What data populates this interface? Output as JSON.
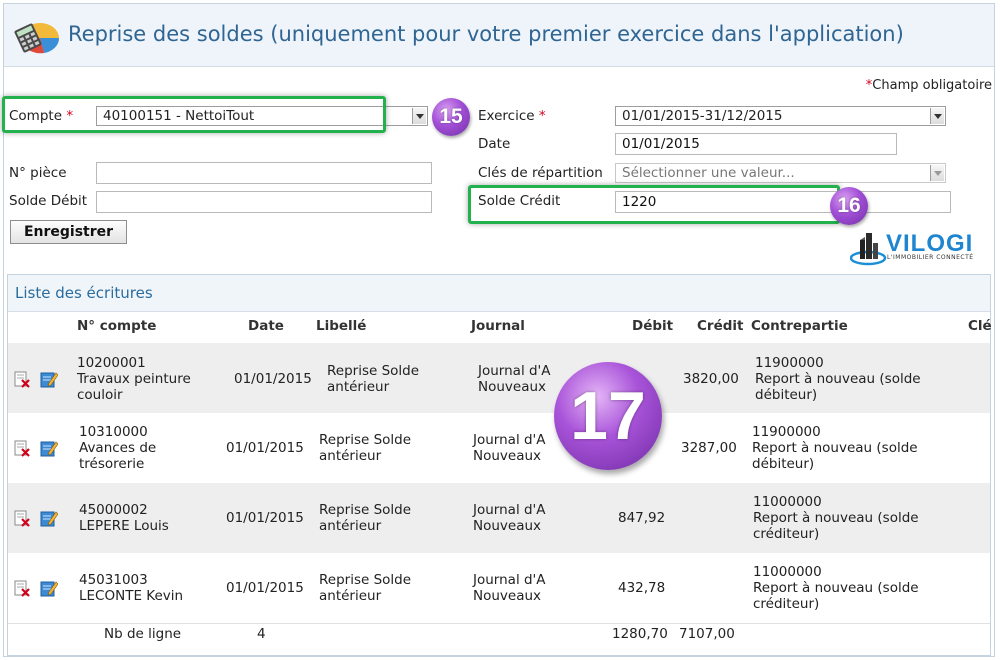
{
  "page": {
    "title": "Reprise des soldes (uniquement pour votre premier exercice dans l'application)",
    "required_note_star": "*",
    "required_note": "Champ obligatoire"
  },
  "form": {
    "compte_label": "Compte",
    "compte_required": "*",
    "compte_value": "40100151 - NettoiTout",
    "exercice_label": "Exercice",
    "exercice_required": "*",
    "exercice_value": "01/01/2015-31/12/2015",
    "date_label": "Date",
    "date_value": "01/01/2015",
    "piece_label": "N° pièce",
    "piece_value": "",
    "cles_label": "Clés de répartition",
    "cles_placeholder": "Sélectionner une valeur...",
    "solde_debit_label": "Solde Débit",
    "solde_debit_value": "",
    "solde_credit_label": "Solde Crédit",
    "solde_credit_value": "1220",
    "save_label": "Enregistrer"
  },
  "badges": {
    "b15": "15",
    "b16": "16",
    "b17": "17"
  },
  "logo": {
    "text": "VILOGI",
    "tagline": "L'IMMOBILIER CONNECTÉ"
  },
  "list": {
    "title": "Liste des écritures",
    "columns": {
      "compte": "N° compte",
      "date": "Date",
      "libelle": "Libellé",
      "journal": "Journal",
      "debit": "Débit",
      "credit": "Crédit",
      "contrepartie": "Contrepartie",
      "cle": "Clé"
    },
    "rows": [
      {
        "compte_num": "10200001",
        "compte_name_1": "Travaux peinture",
        "compte_name_2": "couloir",
        "date": "01/01/2015",
        "libelle_1": "Reprise Solde",
        "libelle_2": "antérieur",
        "journal_1": "Journal d'A",
        "journal_2": "Nouveaux",
        "debit": "",
        "credit": "3820,00",
        "cp_num": "11900000",
        "cp_1": "Report à nouveau (solde",
        "cp_2": "débiteur)"
      },
      {
        "compte_num": "10310000",
        "compte_name_1": "Avances de",
        "compte_name_2": "trésorerie",
        "date": "01/01/2015",
        "libelle_1": "Reprise Solde",
        "libelle_2": "antérieur",
        "journal_1": "Journal d'A",
        "journal_2": "Nouveaux",
        "debit": "",
        "credit": "3287,00",
        "cp_num": "11900000",
        "cp_1": "Report à nouveau (solde",
        "cp_2": "débiteur)"
      },
      {
        "compte_num": "45000002",
        "compte_name_1": "LEPERE Louis",
        "compte_name_2": "",
        "date": "01/01/2015",
        "libelle_1": "Reprise Solde",
        "libelle_2": "antérieur",
        "journal_1": "Journal d'A",
        "journal_2": "Nouveaux",
        "debit": "847,92",
        "credit": "",
        "cp_num": "11000000",
        "cp_1": "Report à nouveau (solde",
        "cp_2": "créditeur)"
      },
      {
        "compte_num": "45031003",
        "compte_name_1": "LECONTE Kevin",
        "compte_name_2": "",
        "date": "01/01/2015",
        "libelle_1": "Reprise Solde",
        "libelle_2": "antérieur",
        "journal_1": "Journal d'A",
        "journal_2": "Nouveaux",
        "debit": "432,78",
        "credit": "",
        "cp_num": "11000000",
        "cp_1": "Report à nouveau (solde",
        "cp_2": "créditeur)"
      }
    ],
    "footer": {
      "label": "Nb de ligne",
      "count": "4",
      "total_debit": "1280,70",
      "total_credit": "7107,00"
    }
  },
  "icons": {
    "header": "calculator-icon",
    "delete": "delete-icon",
    "edit": "edit-icon"
  },
  "colors": {
    "accent": "#2f6593",
    "highlight": "#22b14c",
    "badge": "#a24fd6"
  }
}
